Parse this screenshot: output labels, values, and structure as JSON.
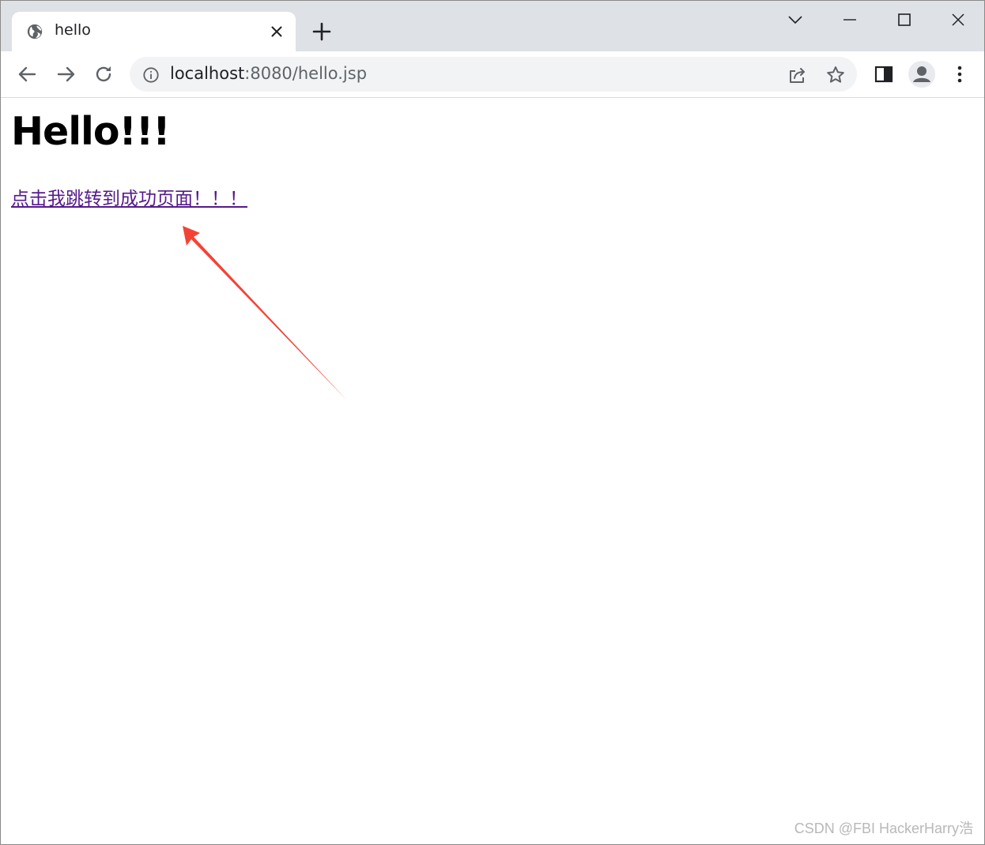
{
  "tab": {
    "title": "hello",
    "favicon": "globe-icon",
    "close_icon": "close-icon"
  },
  "toolbar": {
    "url_host": "localhost",
    "url_rest": ":8080/hello.jsp"
  },
  "page": {
    "heading": "Hello!!!",
    "link_text": "点击我跳转到成功页面！！！"
  },
  "watermark": "CSDN @FBI HackerHarry浩",
  "colors": {
    "link_visited": "#551a8b",
    "arrow": "#f44336",
    "tabstrip_bg": "#dee1e6"
  }
}
